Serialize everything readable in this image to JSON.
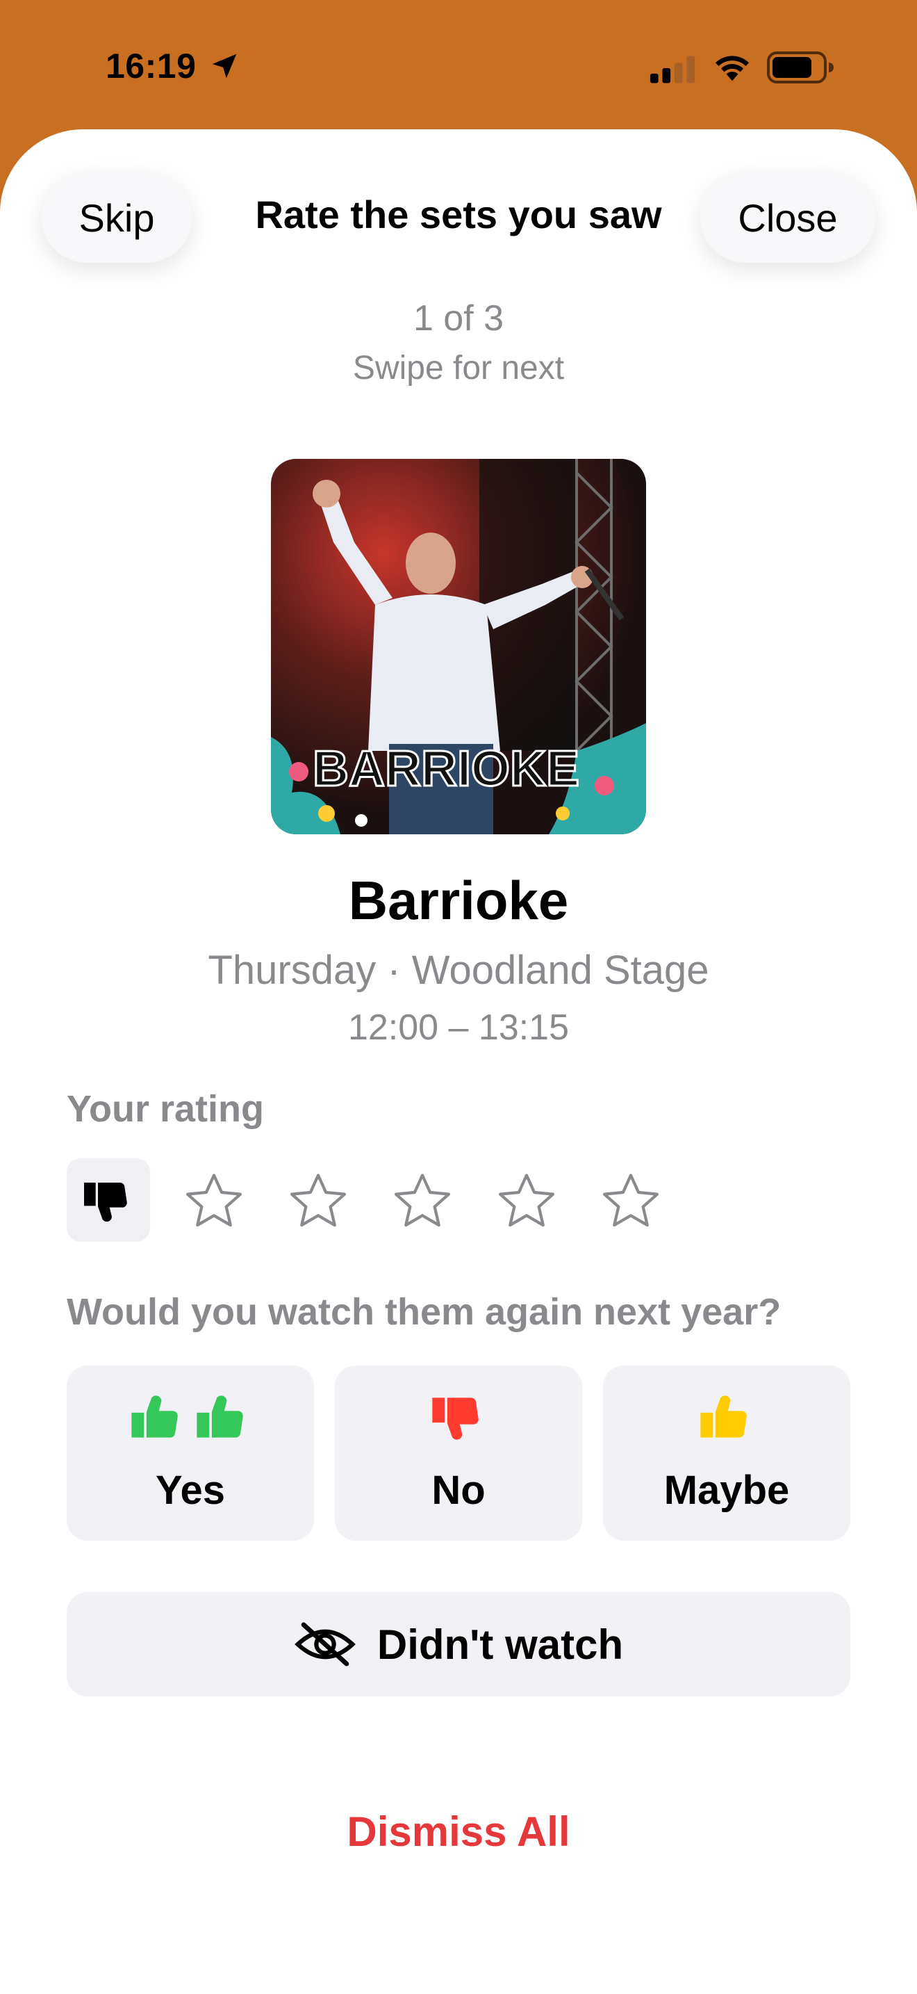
{
  "status_bar": {
    "time": "16:19",
    "icons": [
      "location-arrow-icon",
      "cellular-signal-icon",
      "wifi-icon",
      "battery-icon"
    ]
  },
  "header": {
    "title": "Rate the sets you saw",
    "skip_label": "Skip",
    "close_label": "Close"
  },
  "progress": {
    "counter": "1 of 3",
    "hint": "Swipe for next"
  },
  "artist": {
    "name": "Barrioke",
    "day_stage": "Thursday · Woodland Stage",
    "time": "12:00 – 13:15",
    "artwork_logo_text": "BARRIOKE"
  },
  "rating": {
    "label": "Your rating",
    "thumbs_down_icon": "thumbs-down-icon",
    "stars_total": 5,
    "stars_selected": 0
  },
  "watch_again": {
    "question": "Would you watch them again next year?",
    "options": [
      {
        "label": "Yes",
        "icon": "double-thumbs-up-icon",
        "color": "#34c759"
      },
      {
        "label": "No",
        "icon": "thumbs-down-icon",
        "color": "#ff3b30"
      },
      {
        "label": "Maybe",
        "icon": "thumbs-up-icon",
        "color": "#ffcc00"
      }
    ]
  },
  "didnt_watch": {
    "label": "Didn't watch",
    "icon": "eye-slash-icon"
  },
  "dismiss_all_label": "Dismiss All",
  "colors": {
    "header_background": "#c96f22",
    "secondary_text": "#8a8a8e",
    "destructive": "#e5383b",
    "button_fill": "#f2f2f6"
  }
}
